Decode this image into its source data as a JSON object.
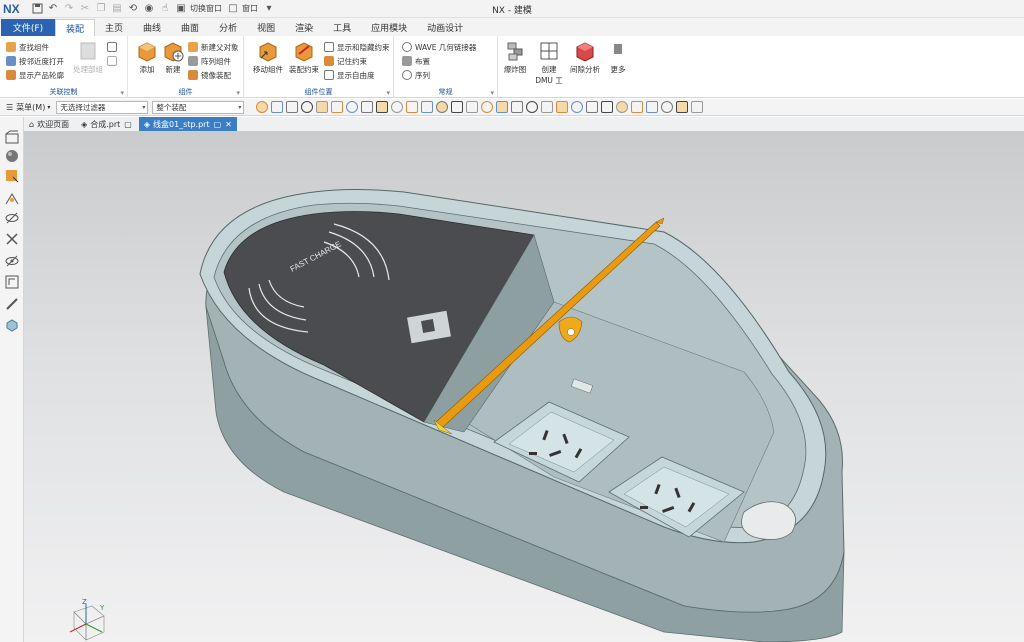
{
  "app": {
    "logo": "NX",
    "title": "NX - 建模",
    "switch_window": "切换窗口",
    "window_menu": "窗口"
  },
  "tabs": {
    "file": "文件(F)",
    "items": [
      "装配",
      "主页",
      "曲线",
      "曲面",
      "分析",
      "视图",
      "渲染",
      "工具",
      "应用模块",
      "动画设计"
    ],
    "active": "装配"
  },
  "ribbon": {
    "assembly_control": {
      "label": "关联控制",
      "items": [
        "查找组件",
        "按邻近度打开",
        "显示产品轮廓"
      ],
      "disabled_big": "处理部组"
    },
    "components": {
      "label": "组件",
      "add": "添加",
      "new": "新建",
      "items": [
        "新建父对象",
        "阵列组件",
        "镜像装配"
      ]
    },
    "component_position": {
      "label": "组件位置",
      "move": "移动组件",
      "constraint": "装配约束",
      "items": [
        "显示和隐藏约束",
        "记住约束",
        "显示自由度"
      ]
    },
    "general": {
      "label": "常规",
      "items": [
        "WAVE 几何链接器",
        "布置",
        "序列"
      ]
    },
    "explode": "爆炸图",
    "dmu": [
      "创建",
      "DMU 工"
    ],
    "interference": "间隙分析",
    "more": "更多"
  },
  "cmdbar": {
    "menu": "菜单(M)",
    "filter": "无选择过滤器",
    "scope": "整个装配"
  },
  "doc_tabs": [
    {
      "label": "欢迎页面",
      "active": false
    },
    {
      "label": "合成.prt",
      "active": false
    },
    {
      "label": "线盒01_stp.prt",
      "active": true
    }
  ],
  "model": {
    "pad_text": "FAST CHARGE"
  },
  "colors": {
    "accent": "#2b63b0",
    "doc_tab_active": "#3a7fc4",
    "shell": "#a9b8ba",
    "pad": "#4a4c4f",
    "socket": "#b9cdd0",
    "lever": "#e09a10"
  }
}
